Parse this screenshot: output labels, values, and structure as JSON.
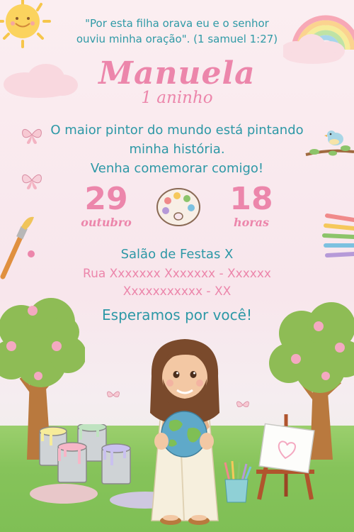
{
  "verse": {
    "line1": "\"Por esta filha orava eu e o senhor",
    "line2": "ouviu minha oração\". (1 samuel 1:27)"
  },
  "name": "Manuela",
  "age": "1 aninho",
  "message": {
    "line1": "O maior pintor do mundo está pintando",
    "line2": "minha história.",
    "line3": "Venha comemorar comigo!"
  },
  "date": {
    "day": "29",
    "month": "outubro"
  },
  "time": {
    "hour": "18",
    "unit": "horas"
  },
  "venue": "Salão de Festas X",
  "address": {
    "line1": "Rua Xxxxxxx Xxxxxxx - Xxxxxx",
    "line2": "Xxxxxxxxxxx - XX"
  },
  "closing": "Esperamos por você!",
  "colors": {
    "pink": "#ec86ab",
    "teal": "#2d98a6",
    "background": "#fbeef1",
    "grass": "#86c35a"
  },
  "decorations": [
    "sun-icon",
    "cloud-icon",
    "rainbow-icon",
    "butterfly-icon",
    "bird-icon",
    "palette-icon",
    "paintbrush-icon",
    "colored-pencils-icon",
    "tree-icon",
    "paint-can-icon",
    "easel-icon",
    "jesus-figure",
    "globe-icon"
  ]
}
